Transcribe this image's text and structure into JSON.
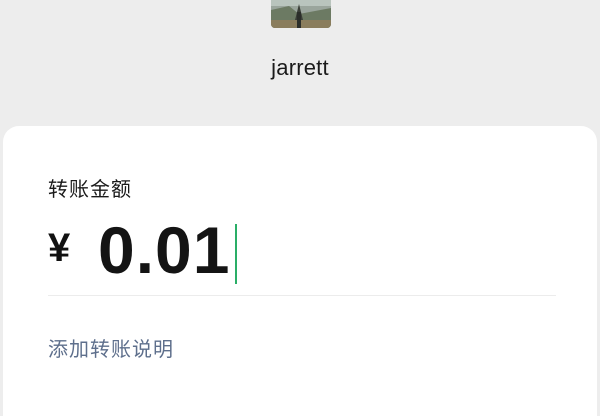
{
  "payee": {
    "avatar_icon": "landscape-photo-avatar",
    "name": "jarrett"
  },
  "transfer": {
    "amount_label": "转账金额",
    "currency_symbol": "¥",
    "amount_value": "0.01",
    "add_note_link": "添加转账说明"
  },
  "colors": {
    "page_background": "#ededed",
    "card_background": "#ffffff",
    "caret": "#2aae67",
    "link": "#5e6f8c"
  }
}
